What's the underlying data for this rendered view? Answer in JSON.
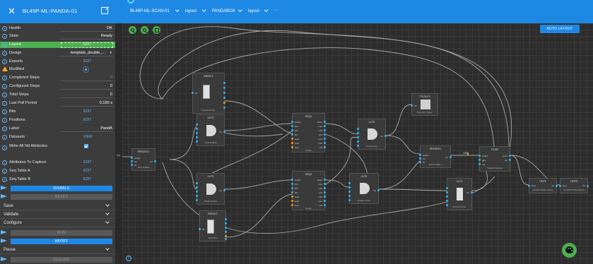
{
  "left_panel": {
    "title": "BL49P-ML-PANDA-01",
    "rows": [
      {
        "label": "Health",
        "value": "OK"
      },
      {
        "label": "State",
        "value": "Ready"
      },
      {
        "label": "Layout",
        "link": "EDIT"
      },
      {
        "label": "Design",
        "value": "template_double_..."
      },
      {
        "label": "Exports",
        "link": "EDIT"
      },
      {
        "label": "Modified"
      },
      {
        "label": "Completed Steps",
        "value": "0"
      },
      {
        "label": "Configured Steps",
        "value": "0"
      },
      {
        "label": "Total Steps",
        "value": "0"
      },
      {
        "label": "Last Poll Period",
        "value": "0.100 s"
      },
      {
        "label": "Bits",
        "link": "EDIT"
      },
      {
        "label": "Positions",
        "link": "EDIT"
      },
      {
        "label": "Label",
        "value": "PandA"
      },
      {
        "label": "Datasets",
        "link": "VIEW"
      },
      {
        "label": "Write All Nd Attributes"
      },
      {
        "label": "Attributes To Capture",
        "link": "EDIT"
      },
      {
        "label": "Seq Table A",
        "link": "EDIT"
      },
      {
        "label": "Seq Table B",
        "link": "EDIT"
      }
    ],
    "buttons": {
      "disable": "DISABLE",
      "reset": "RESET",
      "run": "RUN",
      "abort": "ABORT",
      "resume": "RESUME"
    },
    "sections": {
      "save": "Save",
      "validate": "Validate",
      "configure": "Configure",
      "pause": "Pause"
    }
  },
  "topbar": {
    "crumbs": [
      "BL49P-ML-SCAN-01",
      "layout",
      "PANDABOX",
      "layout",
      "···"
    ]
  },
  "canvas": {
    "auto_layout": "AUTO LAYOUT",
    "blocks": {
      "inenc1": {
        "name": "INENC1",
        "desc": "Input Encoder",
        "lports": [
          "clk"
        ],
        "rports": [
          "a",
          "b",
          "z",
          "data",
          "conn",
          "val"
        ]
      },
      "lut2": {
        "name": "LUT2",
        "desc": "Input Enable",
        "lports": [
          "inpa",
          "inpb",
          "inpc",
          "inpd",
          "inpe"
        ],
        "rports": [
          "out"
        ]
      },
      "lut3": {
        "name": "LUT3",
        "desc": "Single Enable",
        "lports": [
          "inpa",
          "inpb",
          "inpc",
          "inpd",
          "inpe"
        ],
        "rports": [
          "out"
        ]
      },
      "seq1": {
        "name": "SEQ1",
        "desc": "Single",
        "lports": [
          "enable",
          "bita",
          "bitb",
          "bitc",
          "posa",
          "posb",
          "posc"
        ],
        "rports": [
          "active",
          "outa",
          "outb",
          "outc",
          "outd",
          "oute",
          "outf"
        ]
      },
      "seq2": {
        "name": "SEQ2",
        "desc": "Single",
        "lports": [
          "enable",
          "bita",
          "bitb",
          "bitc",
          "posa",
          "posb",
          "posc"
        ],
        "rports": [
          "active",
          "outa",
          "outb",
          "outc",
          "outd",
          "oute",
          "outf"
        ]
      },
      "lut4": {
        "name": "LUT4",
        "desc": "Long Frame",
        "lports": [
          "inpa",
          "inpb",
          "inpc",
          "inpd",
          "inpe"
        ],
        "rports": [
          "out"
        ]
      },
      "lut5": {
        "name": "LUT5",
        "desc": "Ready Frame",
        "lports": [
          "inpa",
          "inpb",
          "inpc",
          "inpd",
          "inpe"
        ],
        "rports": [
          "out"
        ]
      },
      "srgate1": {
        "name": "SRGATE1",
        "desc": "Only Enable",
        "lports": [
          "enable",
          "set",
          "rst"
        ],
        "rports": [
          "out"
        ]
      },
      "srgate2": {
        "name": "SRGATE1",
        "desc": "Frame Gate 1",
        "lports": [
          "enable",
          "set",
          "rst"
        ],
        "rports": [
          "out"
        ]
      },
      "ttlout1": {
        "name": "TTLOUT1",
        "desc": "Detector Trigger",
        "lports": [
          "val"
        ],
        "rports": []
      },
      "pcap": {
        "name": "PCAP",
        "desc": "Position Capture",
        "lports": [
          "enable",
          "gate",
          "trig"
        ],
        "rports": [
          "active",
          "out"
        ]
      },
      "lut1": {
        "name": "LUT1",
        "desc": "End of Frame",
        "lports": [
          "inpa",
          "inpb",
          "inpc",
          "inpd",
          "inpe"
        ],
        "rports": [
          "out"
        ]
      },
      "inenc2": {
        "name": "INENC2",
        "desc": "Input Enc",
        "lports": [
          "clk"
        ],
        "rports": [
          "a",
          "b",
          "z",
          "data",
          "conn",
          "val"
        ]
      },
      "hdf5": {
        "name": "HDF5",
        "desc": "Nd HDF Writer Frame",
        "lports": [
          "input"
        ],
        "rports": [
          "out"
        ]
      },
      "hdf5b": {
        "name": "HDF5",
        "desc": "Nd HDF5 Writer Frame",
        "lports": [
          "input"
        ],
        "rports": [
          "out"
        ]
      }
    },
    "edge_labels": {
      "one": "ONE",
      "inp": "inp"
    }
  }
}
